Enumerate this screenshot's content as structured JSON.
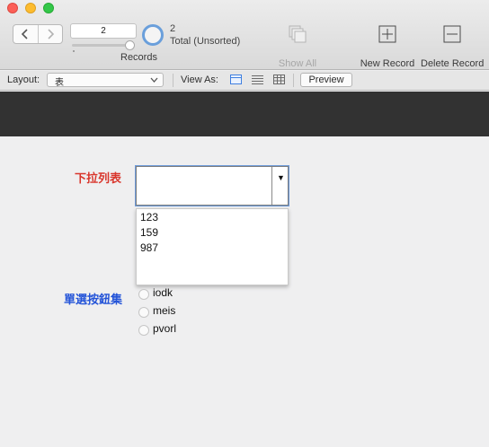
{
  "toolbar": {
    "record_value": "2",
    "records_label": "Records",
    "found_count": "2",
    "total_label": "Total (Unsorted)",
    "show_all_label": "Show All",
    "new_record_label": "New Record",
    "delete_record_label": "Delete Record"
  },
  "layout_bar": {
    "layout_label": "Layout:",
    "layout_value": "表",
    "view_as_label": "View As:",
    "preview_label": "Preview"
  },
  "form": {
    "dropdown_label": "下拉列表",
    "dropdown_options": [
      "123",
      "159",
      "987"
    ],
    "radio_label": "單選按鈕集",
    "radio_options": [
      "iodk",
      "meis",
      "pvorl"
    ]
  },
  "colors": {
    "dropdown_label": "#d9362c",
    "radio_label": "#2454d8",
    "focus_ring": "#6d9ad9",
    "header_band": "#323232"
  }
}
